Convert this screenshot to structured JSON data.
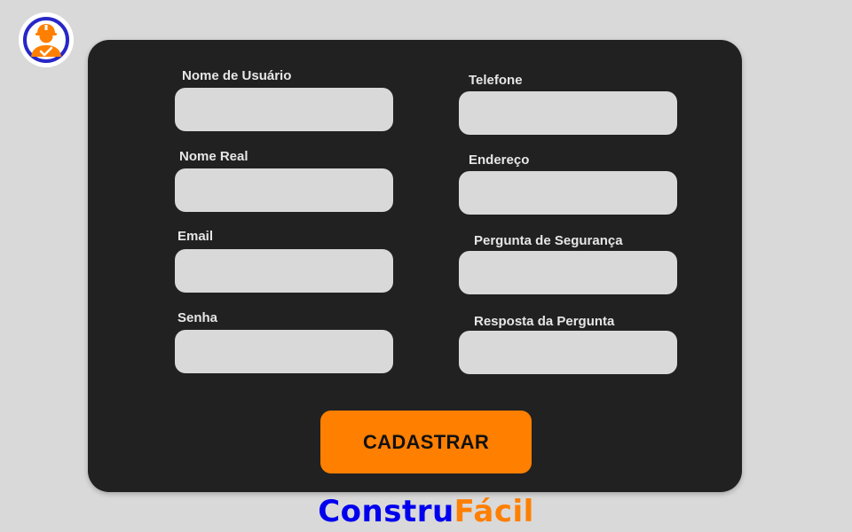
{
  "form": {
    "left_fields": [
      {
        "label": "Nome de Usuário",
        "value": "",
        "placeholder": ""
      },
      {
        "label": "Nome Real",
        "value": "",
        "placeholder": ""
      },
      {
        "label": "Email",
        "value": "",
        "placeholder": ""
      },
      {
        "label": "Senha",
        "value": "",
        "placeholder": ""
      }
    ],
    "right_fields": [
      {
        "label": "Telefone",
        "value": "",
        "placeholder": ""
      },
      {
        "label": "Endereço",
        "value": "",
        "placeholder": ""
      },
      {
        "label": "Pergunta de Segurança",
        "value": "",
        "placeholder": ""
      },
      {
        "label": "Resposta da Pergunta",
        "value": "",
        "placeholder": ""
      }
    ],
    "submit_label": "CADASTRAR"
  },
  "brand": {
    "part1": "Constru",
    "part2": "Fácil"
  },
  "logo": {
    "icon": "construction-worker-icon"
  },
  "colors": {
    "background": "#d9d9d9",
    "card": "#212121",
    "input": "#d9d9d9",
    "accent_orange": "#ff7f00",
    "brand_blue": "#0000ee",
    "logo_ring": "#2727c7"
  }
}
